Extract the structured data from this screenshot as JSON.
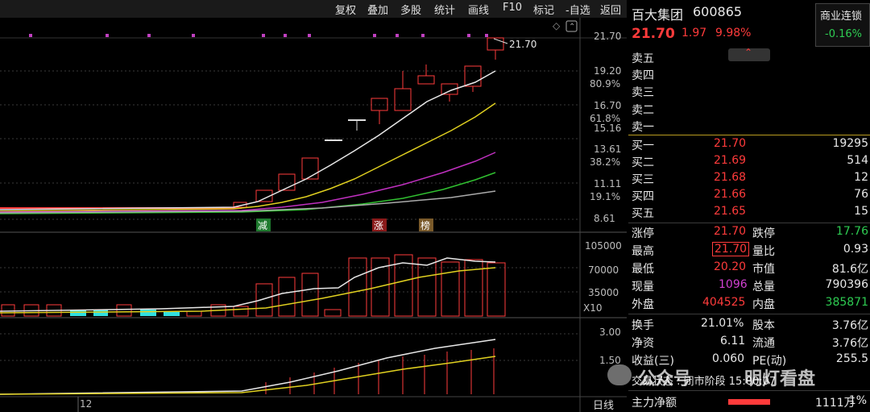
{
  "toolbar": {
    "items": [
      "复权",
      "叠加",
      "多股",
      "统计",
      "画线",
      "F10",
      "标记",
      "-自选",
      "返回"
    ]
  },
  "chart_labels": {
    "price_ticks": [
      "21.70",
      "19.20",
      "16.70",
      "15.16",
      "13.61",
      "11.11",
      "8.61"
    ],
    "pct_ticks": [
      "80.9%",
      "61.8%",
      "38.2%",
      "19.1%"
    ],
    "price_tag": "21.70",
    "vol_ticks": [
      "105000",
      "70000",
      "35000"
    ],
    "vol_unit": "X10",
    "ind_ticks": [
      "3.00",
      "1.50"
    ],
    "date_label": "12",
    "period": "日线",
    "marks": [
      "减",
      "涨",
      "榜"
    ]
  },
  "stock": {
    "name": "百大集团",
    "code": "600865",
    "price": "21.70",
    "change": "1.97",
    "pct": "9.98%"
  },
  "sector": {
    "name": "商业连锁",
    "pct": "-0.16%"
  },
  "asks": [
    "卖五",
    "卖四",
    "卖三",
    "卖二",
    "卖一"
  ],
  "bids": [
    {
      "label": "买一",
      "price": "21.70",
      "vol": "19295"
    },
    {
      "label": "买二",
      "price": "21.69",
      "vol": "514"
    },
    {
      "label": "买三",
      "price": "21.68",
      "vol": "12"
    },
    {
      "label": "买四",
      "price": "21.66",
      "vol": "76"
    },
    {
      "label": "买五",
      "price": "21.65",
      "vol": "15"
    }
  ],
  "stats": [
    {
      "l1": "涨停",
      "v1": "21.70",
      "l2": "跌停",
      "v2": "17.76"
    },
    {
      "l1": "最高",
      "v1": "21.70",
      "l2": "量比",
      "v2": "0.93"
    },
    {
      "l1": "最低",
      "v1": "20.20",
      "l2": "市值",
      "v2": "81.6亿"
    },
    {
      "l1": "现量",
      "v1": "1096",
      "l2": "总量",
      "v2": "790396"
    },
    {
      "l1": "外盘",
      "v1": "404525",
      "l2": "内盘",
      "v2": "385871"
    }
  ],
  "stats2": [
    {
      "l1": "换手",
      "v1": "21.01%",
      "l2": "股本",
      "v2": "3.76亿"
    },
    {
      "l1": "净资",
      "v1": "6.11",
      "l2": "流通",
      "v2": "3.76亿"
    },
    {
      "l1": "收益(三)",
      "v1": "0.060",
      "l2": "PE(动)",
      "v2": "255.5"
    }
  ],
  "trade_status": "交易状态 : 闭市阶段 15:00:07",
  "main_flow": {
    "label": "主力净额",
    "value": "1111万",
    "pct": "1%"
  },
  "watermark": {
    "a": "公众号",
    "b": "明灯看盘"
  },
  "colors": {
    "up": "#ff3b3b",
    "down": "#2ecc52",
    "bg": "#000000"
  }
}
